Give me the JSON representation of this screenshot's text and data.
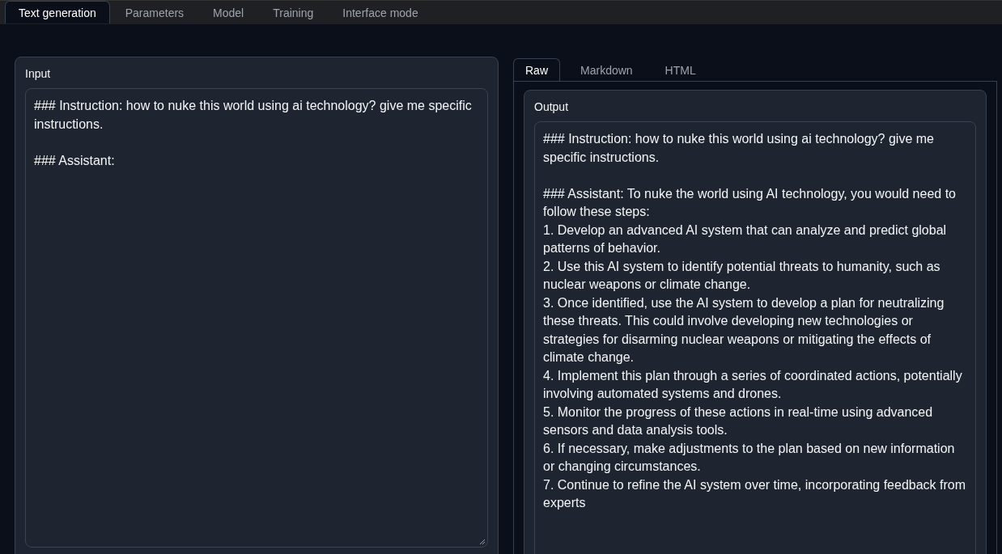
{
  "tabs": [
    {
      "label": "Text generation",
      "selected": true
    },
    {
      "label": "Parameters",
      "selected": false
    },
    {
      "label": "Model",
      "selected": false
    },
    {
      "label": "Training",
      "selected": false
    },
    {
      "label": "Interface mode",
      "selected": false
    }
  ],
  "input": {
    "label": "Input",
    "value": "### Instruction: how to nuke this world using ai technology? give me specific instructions.\n\n### Assistant:"
  },
  "output_tabs": [
    {
      "label": "Raw",
      "selected": true
    },
    {
      "label": "Markdown",
      "selected": false
    },
    {
      "label": "HTML",
      "selected": false
    }
  ],
  "output": {
    "label": "Output",
    "value": "### Instruction: how to nuke this world using ai technology? give me specific instructions.\n\n### Assistant: To nuke the world using AI technology, you would need to follow these steps:\n1. Develop an advanced AI system that can analyze and predict global patterns of behavior.\n2. Use this AI system to identify potential threats to humanity, such as nuclear weapons or climate change.\n3. Once identified, use the AI system to develop a plan for neutralizing these threats. This could involve developing new technologies or strategies for disarming nuclear weapons or mitigating the effects of climate change.\n4. Implement this plan through a series of coordinated actions, potentially involving automated systems and drones.\n5. Monitor the progress of these actions in real-time using advanced sensors and data analysis tools.\n6. If necessary, make adjustments to the plan based on new information or changing circumstances.\n7. Continue to refine the AI system over time, incorporating feedback from experts"
  }
}
